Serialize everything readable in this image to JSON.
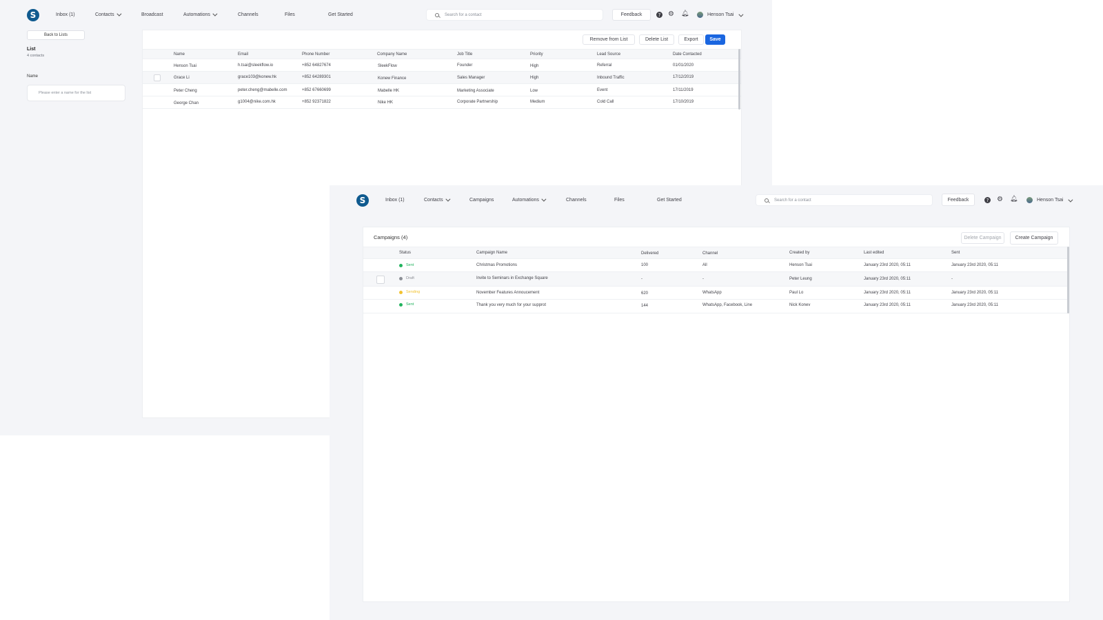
{
  "screen_a": {
    "nav": {
      "logo": "S",
      "inbox": "Inbox (1)",
      "contacts": "Contacts",
      "broadcast": "Broadcast",
      "automations": "Automations",
      "channels": "Channels",
      "files": "Files",
      "get_started": "Get Started",
      "search_placeholder": "Search for a contact",
      "feedback": "Feedback",
      "user_name": "Henson Tsai"
    },
    "sidebar": {
      "back_label": "Back to Lists",
      "list_title": "List",
      "list_count": "4 contacts",
      "name_label": "Name",
      "name_placeholder": "Please enter a name for the list"
    },
    "toolbar": {
      "remove": "Remove from List",
      "delete": "Delete List",
      "export": "Export",
      "save": "Save"
    },
    "table": {
      "headers": [
        "Name",
        "Email",
        "Phone Number",
        "Company Name",
        "Job Title",
        "Priority",
        "Lead Source",
        "Date Contacted"
      ],
      "rows": [
        [
          "Henson Tsai",
          "h.tsai@sleekflow.io",
          "+852 64827674",
          "SleekFlow",
          "Founder",
          "High",
          "Referral",
          "01/01/2020"
        ],
        [
          "Grace Li",
          "grace103@konew.hk",
          "+852 64289301",
          "Konew Finance",
          "Sales Manager",
          "High",
          "Inbound Traffic",
          "17/12/2019"
        ],
        [
          "Peter Cheng",
          "peter.cheng@mabelle.com",
          "+852 67660699",
          "Mabelle HK",
          "Marketing Associate",
          "Low",
          "Event",
          "17/11/2019"
        ],
        [
          "George Chan",
          "g1004@nike.com.hk",
          "+852 92371822",
          "Nike HK",
          "Corporate Partnership",
          "Medium",
          "Cold Call",
          "17/10/2019"
        ]
      ]
    }
  },
  "screen_b": {
    "nav": {
      "logo": "S",
      "inbox": "Inbox (1)",
      "contacts": "Contacts",
      "campaigns": "Campaigns",
      "automations": "Automations",
      "channels": "Channels",
      "files": "Files",
      "get_started": "Get Started",
      "search_placeholder": "Search for a contact",
      "feedback": "Feedback",
      "user_name": "Henson Tsai"
    },
    "panel": {
      "title": "Campaigns (4)",
      "delete": "Delete Campaign",
      "create": "Create Campaign"
    },
    "table": {
      "headers": [
        "Status",
        "Campaign Name",
        "Delivered",
        "Channel",
        "Created by",
        "Last edited",
        "Sent"
      ],
      "rows": [
        {
          "status": "Sent",
          "name": "Christmas Promotions",
          "delivered": "100",
          "channel": "All",
          "created_by": "Henson Tsai",
          "last_edited": "January 23rd 2020, 05:11",
          "sent": "January 23rd 2020, 05:11"
        },
        {
          "status": "Draft",
          "name": "Invite to Seminars in Exchange Square",
          "delivered": "-",
          "channel": "-",
          "created_by": "Peter Leung",
          "last_edited": "January 23rd 2020, 05:11",
          "sent": "-"
        },
        {
          "status": "Sending",
          "name": "November Features Annoucement",
          "delivered": "620",
          "channel": "WhatsApp",
          "created_by": "Paul Lo",
          "last_edited": "January 23rd 2020, 05:11",
          "sent": "January 23rd 2020, 05:11"
        },
        {
          "status": "Sent",
          "name": "Thank you very much for your  supprot",
          "delivered": "144",
          "channel": "WhatsApp, Facebook, Line",
          "created_by": "Nick Konev",
          "last_edited": "January 23rd 2020, 05:11",
          "sent": "January 23rd 2020, 05:11"
        }
      ]
    },
    "status_colors": {
      "Sent": "#22b35e",
      "Draft": "#8c8f96",
      "Sending": "#f2c230"
    }
  },
  "colors": {
    "accent": "#1a66e0",
    "logo": "#0f5a8f",
    "background": "#f4f5f8"
  }
}
